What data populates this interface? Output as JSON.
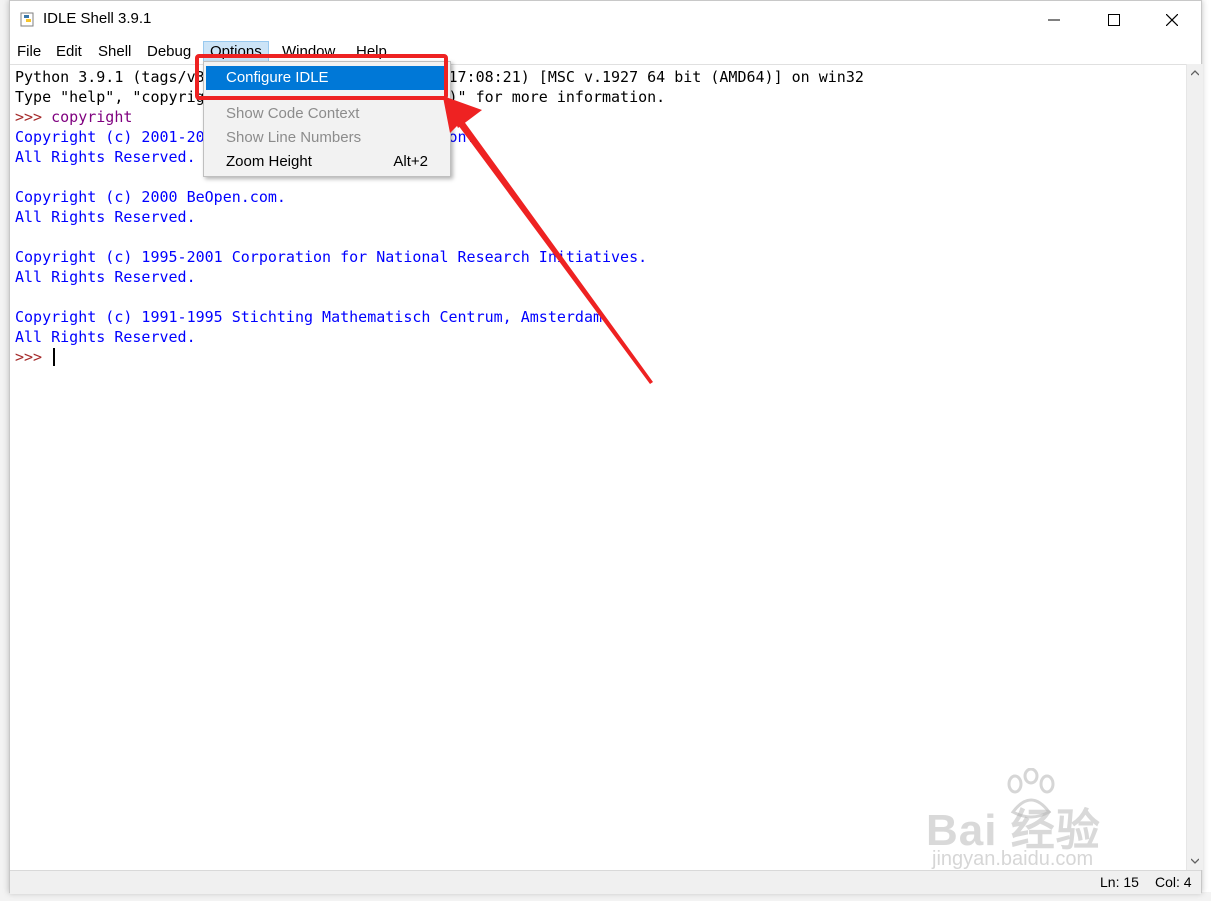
{
  "window": {
    "title": "IDLE Shell 3.9.1"
  },
  "menubar": {
    "items": [
      "File",
      "Edit",
      "Shell",
      "Debug",
      "Options",
      "Window",
      "Help"
    ]
  },
  "shell": {
    "lines": [
      {
        "text": "Python 3.9.1 (tags/v3.9.1:1e5d33e, Dec  7 2020, 17:08:21) [MSC v.1927 64 bit (AMD64)] on win32",
        "color": "#000000"
      },
      {
        "text": "Type \"help\", \"copyright\", \"credits\" or \"license()\" for more information.",
        "color": "#000000"
      },
      {
        "prompt": ">>> ",
        "input": "copyright"
      },
      {
        "text": "Copyright (c) 2001-2020 Python Software Foundation.",
        "color": "#0000ff"
      },
      {
        "text": "All Rights Reserved.",
        "color": "#0000ff"
      },
      {
        "text": "",
        "color": "#0000ff"
      },
      {
        "text": "Copyright (c) 2000 BeOpen.com.",
        "color": "#0000ff"
      },
      {
        "text": "All Rights Reserved.",
        "color": "#0000ff"
      },
      {
        "text": "",
        "color": "#0000ff"
      },
      {
        "text": "Copyright (c) 1995-2001 Corporation for National Research Initiatives.",
        "color": "#0000ff"
      },
      {
        "text": "All Rights Reserved.",
        "color": "#0000ff"
      },
      {
        "text": "",
        "color": "#0000ff"
      },
      {
        "text": "Copyright (c) 1991-1995 Stichting Mathematisch Centrum, Amsterdam.",
        "color": "#0000ff"
      },
      {
        "text": "All Rights Reserved.",
        "color": "#0000ff"
      }
    ],
    "final_prompt": ">>> "
  },
  "options_menu": {
    "configure": "Configure IDLE",
    "code_context": "Show Code Context",
    "line_numbers": "Show Line Numbers",
    "zoom_height": "Zoom Height",
    "zoom_shortcut": "Alt+2"
  },
  "statusbar": {
    "line": "Ln: 15",
    "col": "Col: 4"
  },
  "watermark": {
    "brand": "Bai  经验",
    "url": "jingyan.baidu.com"
  },
  "colors": {
    "highlight": "#0078d7",
    "annotation": "#ee2222",
    "prompt": "#a52a2a",
    "output": "#0000ff"
  }
}
